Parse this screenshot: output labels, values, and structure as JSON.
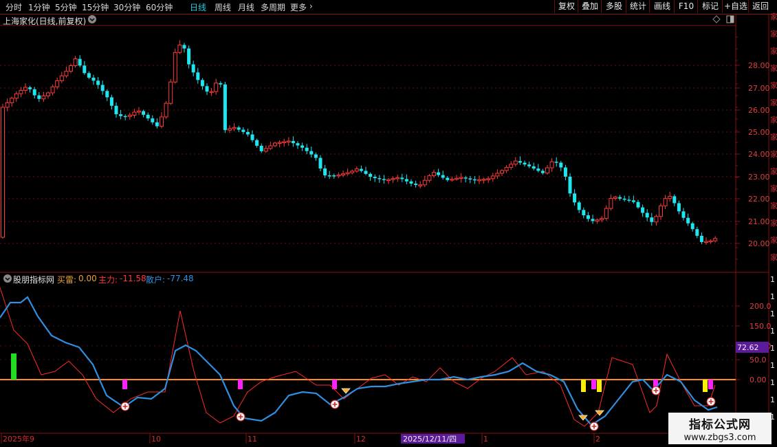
{
  "toolbar": {
    "periods": [
      "分时",
      "1分钟",
      "5分钟",
      "15分钟",
      "30分钟",
      "60分钟",
      "日线",
      "周线",
      "月线",
      "多周期",
      "更多"
    ],
    "active_period": "日线",
    "actions": [
      "复权",
      "叠加",
      "多股",
      "统计",
      "画线",
      "F10",
      "标记",
      "+自选",
      "返回"
    ]
  },
  "main_chart": {
    "title": "上海家化(日线,前复权)",
    "price_levels": [
      "28.00",
      "27.00",
      "26.00",
      "25.00",
      "24.00",
      "23.00",
      "22.00",
      "21.00",
      "20.00"
    ],
    "up_color": "#ff3c3c",
    "down_color": "#1ee6f0"
  },
  "indicator": {
    "name": "股朋指标网",
    "buy_label": "买雷:",
    "buy_value": "0.00",
    "main_label": "主力:",
    "main_value": "-11.58",
    "retail_label": "散户:",
    "retail_value": "-77.48",
    "levels": [
      "200.0",
      "150.0",
      "100.0",
      "50.0",
      "0.00"
    ],
    "current_value_tag": "72.62",
    "main_color": "#ff2a2a",
    "retail_color": "#2f8fe0",
    "zero_color": "#ff8c1e"
  },
  "time_axis": {
    "labels": [
      "2025年9",
      "10",
      "11",
      "12",
      "1",
      "2"
    ],
    "cursor_date": "2025/12/11/四"
  },
  "watermark": {
    "line1": "指标公式网",
    "line2": "www.zbgs3.com"
  }
}
